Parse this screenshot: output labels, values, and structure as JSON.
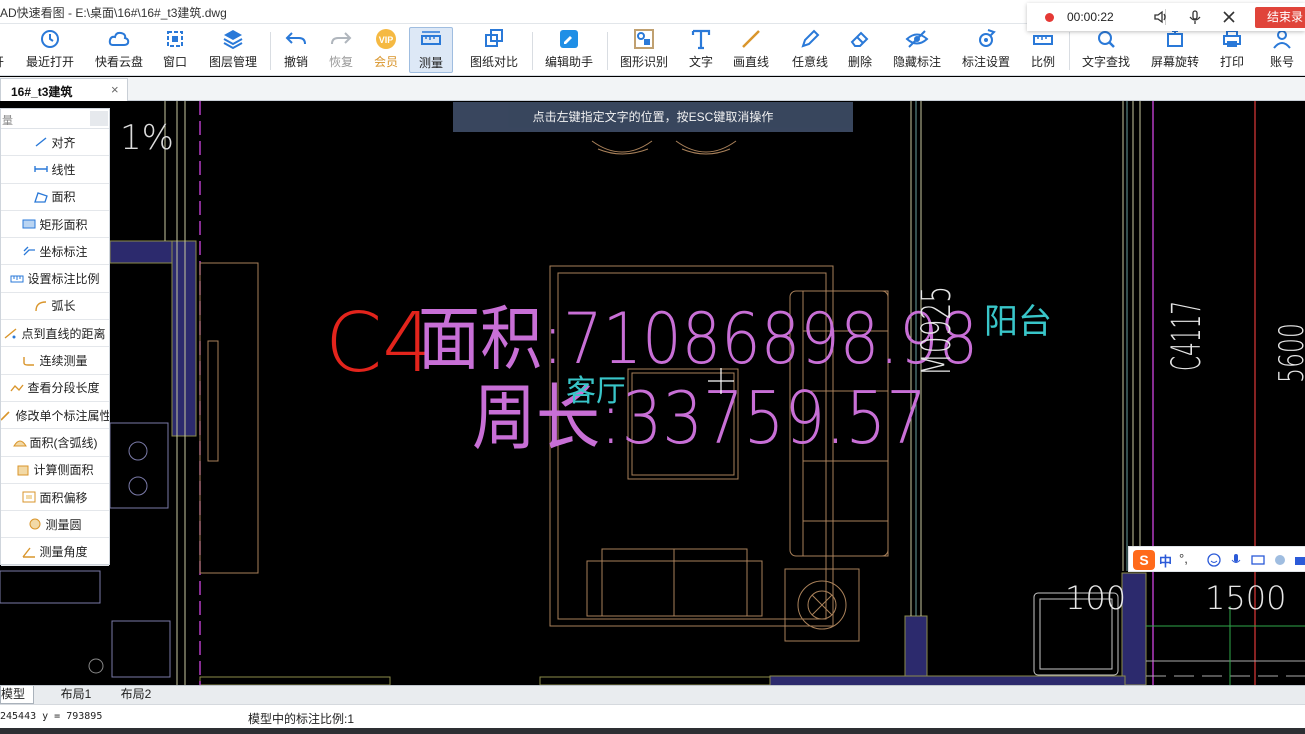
{
  "window": {
    "title": "AD快速看图 - E:\\桌面\\16#\\16#_t3建筑.dwg"
  },
  "toolbar": {
    "items": [
      {
        "label": "开"
      },
      {
        "label": "最近打开"
      },
      {
        "label": "快看云盘"
      },
      {
        "label": "窗口"
      },
      {
        "label": "图层管理"
      },
      {
        "label": "撤销"
      },
      {
        "label": "恢复"
      },
      {
        "label": "会员"
      },
      {
        "label": "测量"
      },
      {
        "label": "图纸对比"
      },
      {
        "label": "编辑助手"
      },
      {
        "label": "图形识别"
      },
      {
        "label": "文字"
      },
      {
        "label": "画直线"
      },
      {
        "label": "任意线"
      },
      {
        "label": "删除"
      },
      {
        "label": "隐藏标注"
      },
      {
        "label": "标注设置"
      },
      {
        "label": "比例"
      },
      {
        "label": "文字查找"
      },
      {
        "label": "屏幕旋转"
      },
      {
        "label": "打印"
      },
      {
        "label": "账号"
      }
    ]
  },
  "recorder": {
    "time": "00:00:22",
    "end_label": "结束录"
  },
  "doc_tab": {
    "name": "16#_t3建筑",
    "close": "×"
  },
  "hint": "点击左键指定文字的位置，按ESC键取消操作",
  "measure_panel": {
    "search_label": "量",
    "items": [
      {
        "label": "对齐"
      },
      {
        "label": "线性"
      },
      {
        "label": "面积"
      },
      {
        "label": "矩形面积"
      },
      {
        "label": "坐标标注"
      },
      {
        "label": "设置标注比例"
      },
      {
        "label": "弧长"
      },
      {
        "label": "点到直线的距离"
      },
      {
        "label": "连续测量"
      },
      {
        "label": "查看分段长度"
      },
      {
        "label": "修改单个标注属性"
      },
      {
        "label": "面积(含弧线)"
      },
      {
        "label": "计算侧面积"
      },
      {
        "label": "面积偏移"
      },
      {
        "label": "测量圆"
      },
      {
        "label": "测量角度"
      }
    ]
  },
  "drawing": {
    "area_text": "面积:71086898.98",
    "perimeter_text": "周长:33759.57",
    "room_living": "客厅",
    "room_balcony": "阳台",
    "label_c4": "C4",
    "label_pct": "1%",
    "label_m0925": "M0925",
    "label_c4117": "C4117",
    "label_5600": "5600",
    "dim_100": "100",
    "dim_1500": "1500"
  },
  "ime": {
    "mode": "中",
    "punct": "°,"
  },
  "layout_tabs": [
    {
      "label": "模型"
    },
    {
      "label": "布局1"
    },
    {
      "label": "布局2"
    }
  ],
  "status": {
    "coord": "245443 y = 793895",
    "scale": "模型中的标注比例:1"
  },
  "colors": {
    "measure_text": "#c86fd6",
    "room_text": "#39c6c9",
    "red_label": "#e3241c",
    "wall_fill": "#2c2a6d",
    "furniture": "#a9815a",
    "accent_blue": "#2a79d8"
  }
}
